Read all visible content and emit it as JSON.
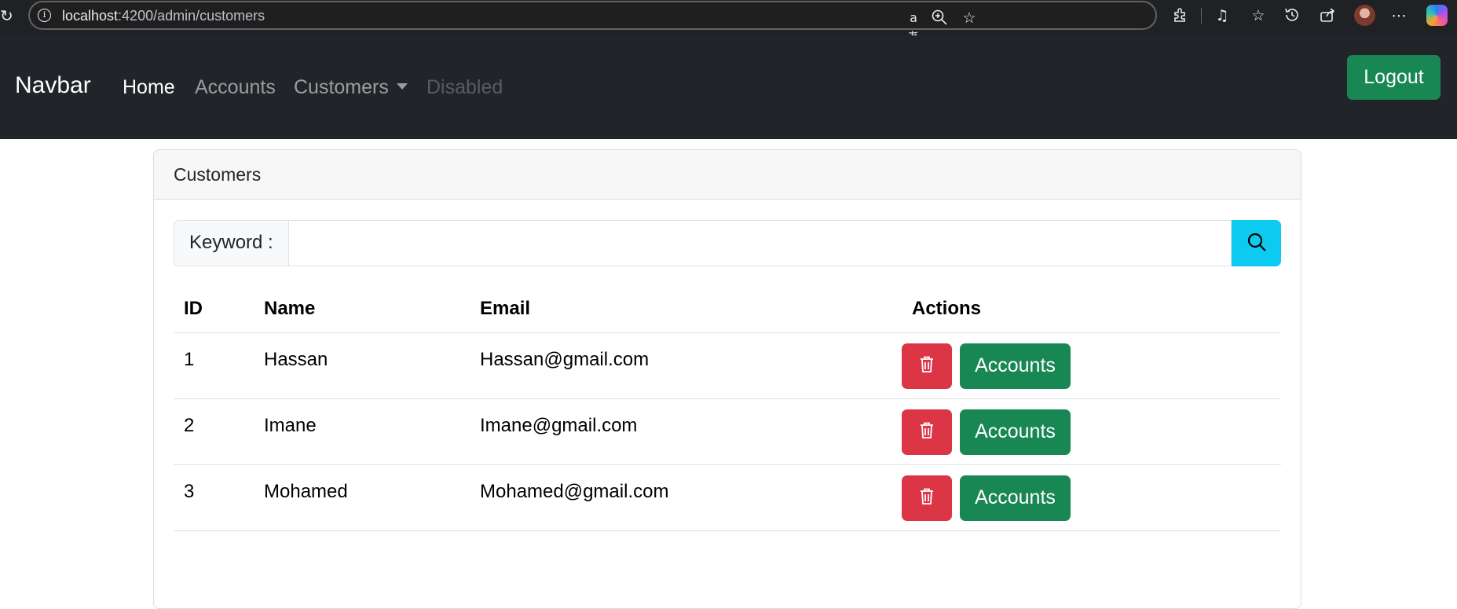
{
  "browser": {
    "url_host": "localhost",
    "url_path": ":4200/admin/customers",
    "icons": [
      "reload-icon",
      "site-info-icon",
      "translate-icon",
      "zoom-icon",
      "favorite-star-icon",
      "extensions-icon",
      "media-icon",
      "favorites-icon",
      "history-icon",
      "share-icon",
      "profile-avatar",
      "more-icon",
      "copilot-icon"
    ]
  },
  "navbar": {
    "brand": "Navbar",
    "links": [
      {
        "label": "Home",
        "state": "active"
      },
      {
        "label": "Accounts",
        "state": "normal"
      },
      {
        "label": "Customers",
        "state": "dropdown"
      },
      {
        "label": "Disabled",
        "state": "disabled"
      }
    ],
    "logout_label": "Logout"
  },
  "card": {
    "title": "Customers",
    "search": {
      "label": "Keyword :",
      "value": "",
      "placeholder": ""
    },
    "table": {
      "headers": [
        "ID",
        "Name",
        "Email",
        "Actions"
      ],
      "rows": [
        {
          "id": "1",
          "name": "Hassan",
          "email": "Hassan@gmail.com",
          "accounts_label": "Accounts"
        },
        {
          "id": "2",
          "name": "Imane",
          "email": "Imane@gmail.com",
          "accounts_label": "Accounts"
        },
        {
          "id": "3",
          "name": "Mohamed",
          "email": "Mohamed@gmail.com",
          "accounts_label": "Accounts"
        }
      ]
    }
  },
  "colors": {
    "navbar_bg": "#212529",
    "success": "#198754",
    "danger": "#dc3545",
    "info": "#0dcaf0"
  }
}
